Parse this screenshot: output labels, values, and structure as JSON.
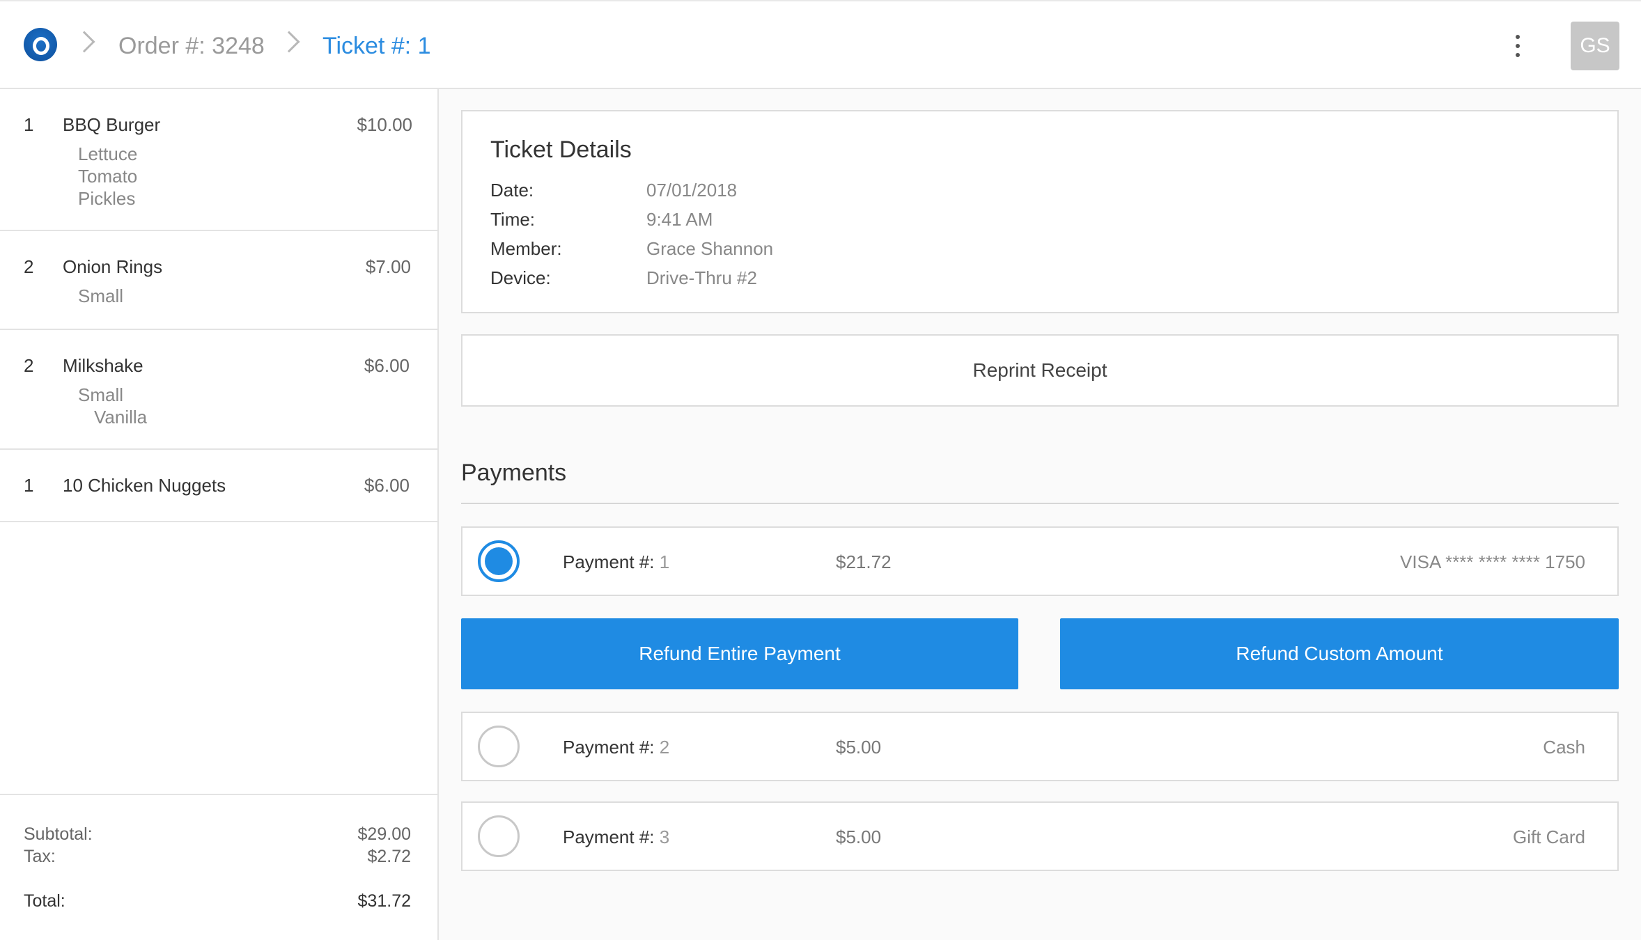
{
  "header": {
    "breadcrumbs": [
      {
        "label": "Order #: 3248"
      },
      {
        "label": "Ticket #: 1"
      }
    ],
    "avatar_initials": "GS",
    "accent_color": "#2b8ce0"
  },
  "order_items": [
    {
      "qty": "1",
      "name": "BBQ Burger",
      "price": "$10.00",
      "modifiers": [
        "Lettuce",
        "Tomato",
        "Pickles"
      ]
    },
    {
      "qty": "2",
      "name": "Onion Rings",
      "price": "$7.00",
      "modifiers": [
        "Small"
      ]
    },
    {
      "qty": "2",
      "name": "Milkshake",
      "price": "$6.00",
      "modifiers": [
        "Small",
        "Vanilla"
      ]
    },
    {
      "qty": "1",
      "name": "10 Chicken Nuggets",
      "price": "$6.00",
      "modifiers": []
    }
  ],
  "totals": {
    "subtotal_label": "Subtotal:",
    "subtotal": "$29.00",
    "tax_label": "Tax:",
    "tax": "$2.72",
    "total_label": "Total:",
    "total": "$31.72"
  },
  "ticket_details": {
    "title": "Ticket Details",
    "rows": [
      {
        "label": "Date:",
        "value": "07/01/2018"
      },
      {
        "label": "Time:",
        "value": "9:41 AM"
      },
      {
        "label": "Member:",
        "value": "Grace Shannon"
      },
      {
        "label": "Device:",
        "value": "Drive-Thru #2"
      }
    ]
  },
  "reprint_label": "Reprint Receipt",
  "payments": {
    "title": "Payments",
    "label_prefix": "Payment #:",
    "items": [
      {
        "number": "1",
        "amount": "$21.72",
        "method": "VISA **** **** **** 1750",
        "selected": true
      },
      {
        "number": "2",
        "amount": "$5.00",
        "method": "Cash",
        "selected": false
      },
      {
        "number": "3",
        "amount": "$5.00",
        "method": "Gift Card",
        "selected": false
      }
    ],
    "refund_entire_label": "Refund Entire Payment",
    "refund_custom_label": "Refund Custom Amount",
    "button_color": "#1f8be3"
  }
}
